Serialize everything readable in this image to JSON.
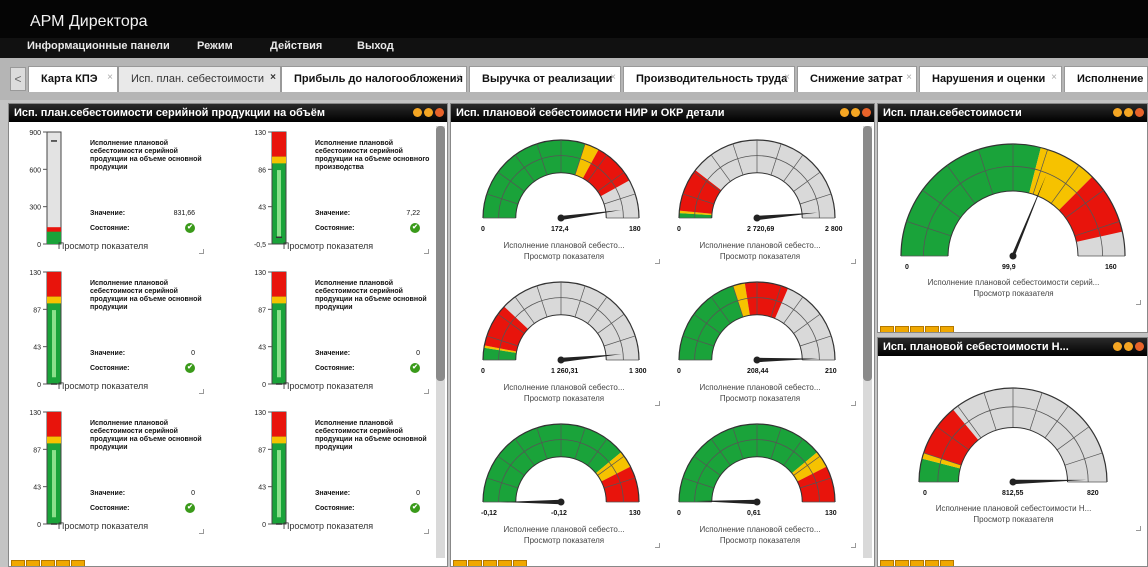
{
  "app": {
    "title": "АРМ Директора"
  },
  "menu": [
    "Информационные панели",
    "Режим",
    "Действия",
    "Выход"
  ],
  "tabs": [
    {
      "label": "Карта КПЭ"
    },
    {
      "label": "Исп. план. себестоимости"
    },
    {
      "label": "Прибыль до налогообложения"
    },
    {
      "label": "Выручка от реализации"
    },
    {
      "label": "Производительность труда"
    },
    {
      "label": "Снижение затрат"
    },
    {
      "label": "Нарушения и оценки"
    },
    {
      "label": "Исполнение Го"
    }
  ],
  "tab_nav_prev": "<",
  "tab_close_glyph": "×",
  "panels": {
    "serial": {
      "title": "Исп. план.себестоимости серийной продукции на объём"
    },
    "nir": {
      "title": "Исп. плановой себестоимости НИР и ОКР детали"
    },
    "plan": {
      "title": "Исп. план.себестоимости"
    },
    "plan2": {
      "title": "Исп. плановой себестоимости Н..."
    }
  },
  "labels": {
    "value": "Значение:",
    "state": "Состояние:",
    "view": "Просмотр показателя",
    "ok_glyph": "✔"
  },
  "thermo_cards": [
    {
      "title": "Исполнение плановой себестоимости серийной продукции на объеме основной продукции",
      "ticks": [
        "900",
        "600",
        "300",
        "0"
      ],
      "value": "831,66",
      "level": 0.92
    },
    {
      "title": "Исполнение плановой себестоимости серийной продукции на объеме основного производства",
      "ticks": [
        "130",
        "86",
        "43",
        "-0,5"
      ],
      "value": "7,22",
      "level": 0.06
    },
    {
      "title": "Исполнение плановой себестоимости серийной продукции на объеме основной продукции",
      "ticks": [
        "130",
        "87",
        "43",
        "0"
      ],
      "value": "0",
      "level": 0
    },
    {
      "title": "Исполнение плановой себестоимости серийной продукции на объеме основной продукции",
      "ticks": [
        "130",
        "87",
        "43",
        "0"
      ],
      "value": "0",
      "level": 0
    },
    {
      "title": "Исполнение плановой себестоимости серийной продукции на объеме основной продукции",
      "ticks": [
        "130",
        "87",
        "43",
        "0"
      ],
      "value": "0",
      "level": 0
    },
    {
      "title": "Исполнение плановой себестоимости серийной продукции на объеме основной продукции",
      "ticks": [
        "130",
        "87",
        "43",
        "0"
      ],
      "value": "0",
      "level": 0
    }
  ],
  "gauges": [
    {
      "min": "0",
      "value": "172,4",
      "max": "180",
      "fraction": 0.958,
      "green_end": 0.6,
      "yellow_end": 0.66,
      "caption": "Исполнение плановой себесто..."
    },
    {
      "min": "0",
      "value": "2 720,69",
      "max": "2 800",
      "fraction": 0.972,
      "green_end": 0.02,
      "yellow_end": 0.03,
      "caption": "Исполнение плановой себесто..."
    },
    {
      "min": "0",
      "value": "1 260,31",
      "max": "1 300",
      "fraction": 0.969,
      "green_end": 0.05,
      "yellow_end": 0.06,
      "caption": "Исполнение плановой себесто..."
    },
    {
      "min": "0",
      "value": "208,44",
      "max": "210",
      "fraction": 0.993,
      "green_end": 0.4,
      "yellow_end": 0.45,
      "caption": "Исполнение плановой себесто..."
    },
    {
      "min": "-0,12",
      "value": "-0,12",
      "max": "130",
      "fraction": 0.0,
      "green_end": 0.78,
      "yellow_end": 0.85,
      "caption": "Исполнение плановой себесто..."
    },
    {
      "min": "0",
      "value": "0,61",
      "max": "130",
      "fraction": 0.005,
      "green_end": 0.78,
      "yellow_end": 0.85,
      "caption": "Исполнение плановой себесто..."
    }
  ],
  "big_gauges": [
    {
      "min": "0",
      "value": "99,9",
      "max": "160",
      "fraction": 0.624,
      "green_end": 0.58,
      "yellow_end": 0.75,
      "caption": "Исполнение плановой себестоимости серий...",
      "link": "Просмотр показателя"
    },
    {
      "min": "0",
      "value": "812,55",
      "max": "820",
      "fraction": 0.991,
      "green_end": 0.08,
      "yellow_end": 0.1,
      "caption": "Исполнение плановой себестоимости Н...",
      "link": "Просмотр показателя"
    }
  ],
  "colors": {
    "green": "#1aa33a",
    "yellow": "#f6c200",
    "red": "#e8140c",
    "gray": "#d9d9d9"
  }
}
